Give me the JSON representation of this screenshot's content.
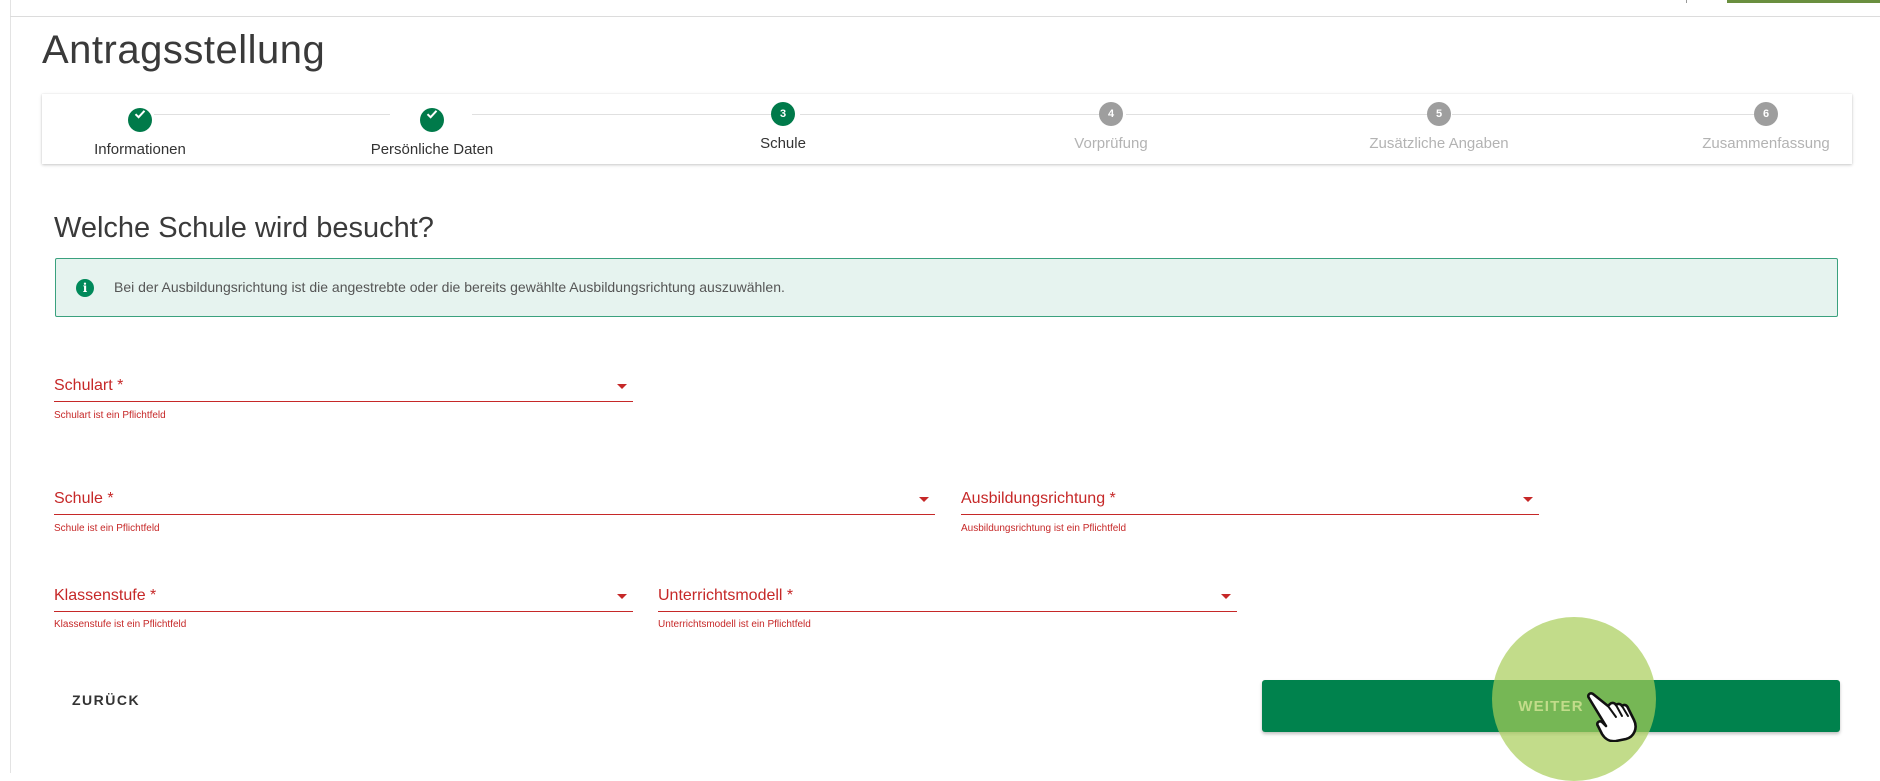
{
  "page": {
    "title": "Antragsstellung"
  },
  "stepper": {
    "steps": [
      {
        "number": "1",
        "label": "Informationen",
        "state": "done"
      },
      {
        "number": "2",
        "label": "Persönliche Daten",
        "state": "done"
      },
      {
        "number": "3",
        "label": "Schule",
        "state": "active"
      },
      {
        "number": "4",
        "label": "Vorprüfung",
        "state": "todo"
      },
      {
        "number": "5",
        "label": "Zusätzliche Angaben",
        "state": "todo"
      },
      {
        "number": "6",
        "label": "Zusammenfassung",
        "state": "todo"
      }
    ]
  },
  "section": {
    "title": "Welche Schule wird besucht?"
  },
  "info": {
    "icon": "info-icon",
    "text": "Bei der Ausbildungsrichtung ist die angestrebte oder die bereits gewählte Ausbildungsrichtung auszuwählen."
  },
  "form": {
    "schulart": {
      "label": "Schulart *",
      "error": "Schulart ist ein Pflichtfeld"
    },
    "schule": {
      "label": "Schule *",
      "error": "Schule ist ein Pflichtfeld"
    },
    "ausbildungsrichtung": {
      "label": "Ausbildungsrichtung *",
      "error": "Ausbildungsrichtung ist ein Pflichtfeld"
    },
    "klassenstufe": {
      "label": "Klassenstufe *",
      "error": "Klassenstufe ist ein Pflichtfeld"
    },
    "unterrichtsmodell": {
      "label": "Unterrichtsmodell *",
      "error": "Unterrichtsmodell ist ein Pflichtfeld"
    }
  },
  "actions": {
    "back_label": "ZURÜCK",
    "next_label": "WEITER"
  },
  "colors": {
    "primary_green": "#00824d",
    "error_red": "#c62828",
    "info_background": "#e6f3ef",
    "click_highlight": "#a8cd58"
  }
}
